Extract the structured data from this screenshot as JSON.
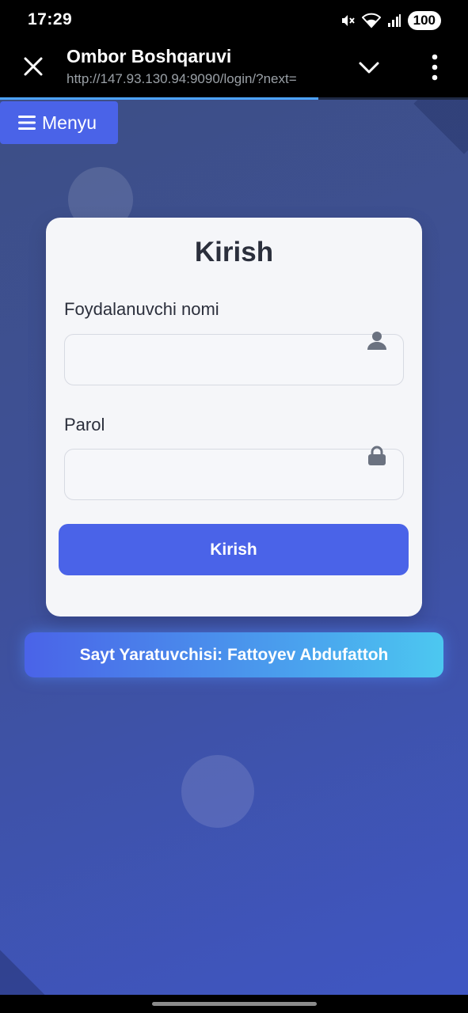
{
  "status_bar": {
    "time": "17:29",
    "battery": "100",
    "icons": [
      "mute-icon",
      "wifi-icon",
      "signal-icon",
      "battery-icon"
    ]
  },
  "browser": {
    "title": "Ombor Boshqaruvi",
    "url": "http://147.93.130.94:9090/login/?next=",
    "load_progress": 0.68,
    "icons": [
      "close-icon",
      "chevron-down-icon",
      "more-vert-icon"
    ]
  },
  "menu": {
    "label": "Menyu",
    "icon": "hamburger-icon"
  },
  "login": {
    "title": "Kirish",
    "username_label": "Foydalanuvchi nomi",
    "username_value": "",
    "username_icon": "user-icon",
    "password_label": "Parol",
    "password_value": "",
    "password_icon": "lock-icon",
    "submit_label": "Kirish"
  },
  "footer": {
    "credit": "Sayt Yaratuvchisi: Fattoyev Abdufattoh"
  },
  "colors": {
    "accent": "#4a63e8",
    "background_start": "#3d4f86",
    "background_end": "#3f56c3",
    "card": "#f5f6f9",
    "progress": "#4da3ff"
  }
}
